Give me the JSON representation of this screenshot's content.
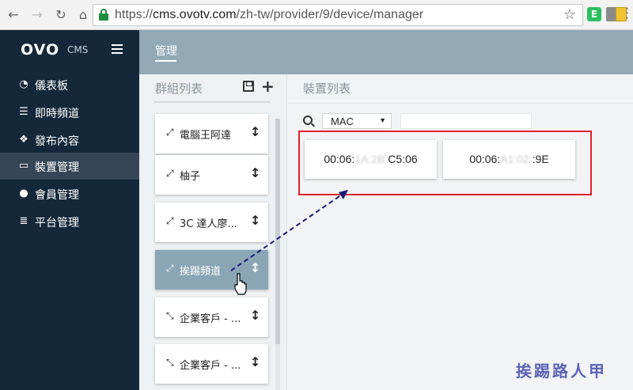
{
  "browser": {
    "url_scheme": "https://",
    "url_host": "cms.ovotv.com",
    "url_path": "/zh-tw/provider/9/device/manager",
    "extension_evernote": "E"
  },
  "sidebar": {
    "logo": "OVO",
    "logo_sub": "CMS",
    "items": [
      {
        "label": "儀表板",
        "icon": "dashboard-icon"
      },
      {
        "label": "即時頻道",
        "icon": "list-icon"
      },
      {
        "label": "發布內容",
        "icon": "cubes-icon"
      },
      {
        "label": "裝置管理",
        "icon": "monitor-icon"
      },
      {
        "label": "會員管理",
        "icon": "user-icon"
      },
      {
        "label": "平台管理",
        "icon": "server-icon"
      }
    ],
    "active_index": 3
  },
  "topbar": {
    "tab": "管理"
  },
  "groups": {
    "title": "群組列表",
    "items": [
      {
        "name": "電腦王阿達",
        "arrow": "⤢"
      },
      {
        "name": "柚子",
        "arrow": "⤢"
      },
      {
        "name": "3C 達人廖...",
        "arrow": "⤢"
      },
      {
        "name": "挨踢頻道",
        "arrow": "⤢"
      },
      {
        "name": "企業客戶 - ...",
        "arrow": "⤡"
      },
      {
        "name": "企業客戶 - ...",
        "arrow": "⤡"
      }
    ],
    "selected_index": 3,
    "sort_glyph": "↕"
  },
  "devices": {
    "title": "裝置列表",
    "filter_option": "MAC",
    "items": [
      {
        "prefix": "00:06:",
        "obscured": "1A:2B:",
        "suffix": "C5:06"
      },
      {
        "prefix": "00:06:",
        "obscured": "A1:02:",
        "suffix": ":9E"
      }
    ]
  },
  "watermark": "挨踢路人甲",
  "colors": {
    "sidebar_bg": "#14283a",
    "topbar_bg": "#92a9b6",
    "selected_group": "#8aa6b5",
    "highlight": "#e0202b",
    "arrow_line": "#1a1a7a"
  }
}
